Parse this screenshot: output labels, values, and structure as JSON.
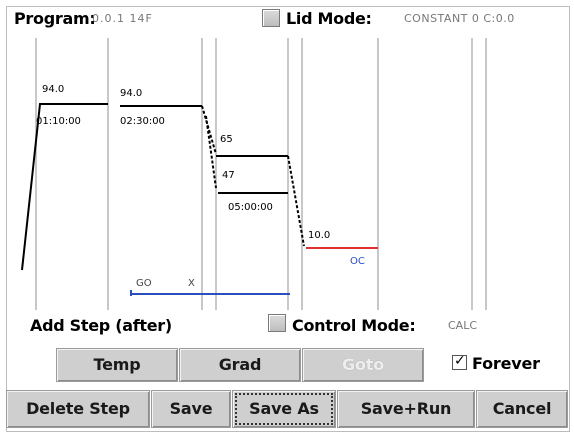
{
  "header": {
    "title": "Program:",
    "program_name": "0.0.1 14F",
    "lid_mode_label": "Lid Mode:",
    "lid_mode_value": "CONSTANT 0 C:0.0"
  },
  "graph": {
    "step1_temp": "94.0",
    "step1_time": "01:10:00",
    "step2_temp": "94.0",
    "step2_time": "02:30:00",
    "step3_temp": "65",
    "step4_temp": "47",
    "step4_time": "05:00:00",
    "step5_temp": "10.0",
    "step5_time": "OC",
    "goto_label": "GO",
    "goto_x": "X"
  },
  "controls": {
    "add_step_label": "Add Step (after)",
    "control_mode_label": "Control Mode:",
    "control_mode_value": "CALC",
    "temp_button": "Temp",
    "grad_button": "Grad",
    "goto_button": "Goto",
    "forever_label": "Forever",
    "forever_checked": true
  },
  "actions": {
    "delete_step": "Delete Step",
    "save": "Save",
    "save_as": "Save As",
    "save_run": "Save+Run",
    "cancel": "Cancel"
  }
}
